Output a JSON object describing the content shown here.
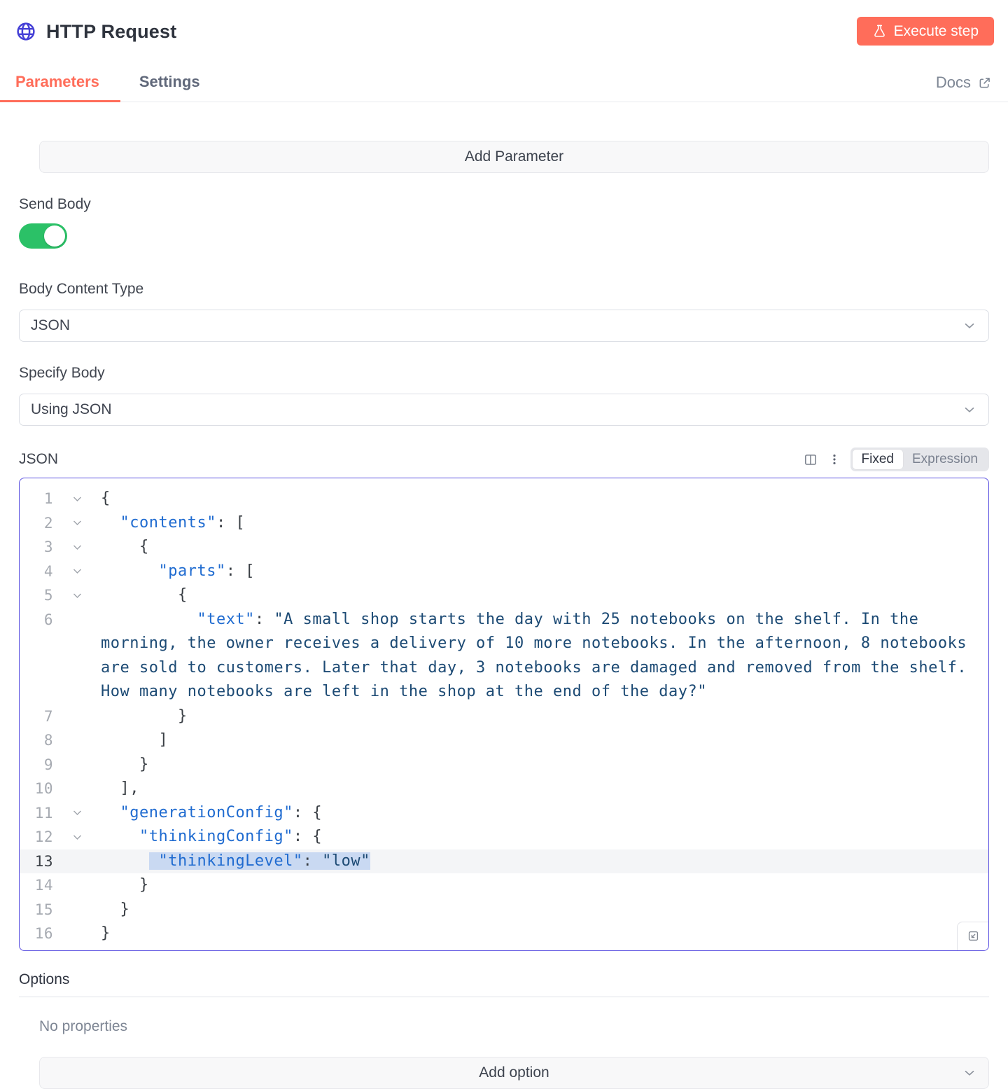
{
  "header": {
    "title": "HTTP Request",
    "execute_button": "Execute step"
  },
  "tabs": {
    "parameters": "Parameters",
    "settings": "Settings",
    "docs": "Docs"
  },
  "params": {
    "add_parameter_label": "Add Parameter",
    "send_body_label": "Send Body",
    "send_body_on": true,
    "body_content_type_label": "Body Content Type",
    "body_content_type_value": "JSON",
    "specify_body_label": "Specify Body",
    "specify_body_value": "Using JSON",
    "json_label": "JSON",
    "mode_fixed": "Fixed",
    "mode_expression": "Expression",
    "options_label": "Options",
    "no_properties_text": "No properties",
    "add_option_label": "Add option"
  },
  "icons": {
    "node": "globe-icon",
    "execute": "flask-icon",
    "docs": "external-link-icon",
    "split": "split-editor-icon",
    "menu": "kebab-menu-icon",
    "expand": "expand-editor-icon"
  },
  "colors": {
    "accent": "#ff6d5a",
    "node-icon": "#4540d6",
    "toggle-green": "#2bc167",
    "sel": "#c9d9f2",
    "tok-key": "#1f6bd0",
    "tok-str": "#1c4a74",
    "tok-punct": "#3a3f45",
    "editor-border": "#5a50e0"
  },
  "editor": {
    "lines": [
      {
        "num": 1,
        "fold": true,
        "segments": [
          {
            "t": "{",
            "c": "p"
          }
        ]
      },
      {
        "num": 2,
        "fold": true,
        "segments": [
          {
            "t": "  ",
            "c": "p"
          },
          {
            "t": "\"contents\"",
            "c": "k"
          },
          {
            "t": ": [",
            "c": "p"
          }
        ]
      },
      {
        "num": 3,
        "fold": true,
        "segments": [
          {
            "t": "    {",
            "c": "p"
          }
        ]
      },
      {
        "num": 4,
        "fold": true,
        "segments": [
          {
            "t": "      ",
            "c": "p"
          },
          {
            "t": "\"parts\"",
            "c": "k"
          },
          {
            "t": ": [",
            "c": "p"
          }
        ]
      },
      {
        "num": 5,
        "fold": true,
        "segments": [
          {
            "t": "        {",
            "c": "p"
          }
        ]
      },
      {
        "num": 6,
        "fold": false,
        "segments": [
          {
            "t": "          ",
            "c": "p"
          },
          {
            "t": "\"text\"",
            "c": "k"
          },
          {
            "t": ": ",
            "c": "p"
          },
          {
            "t": "\"A small shop starts the day with 25 notebooks on the shelf. In the morning, the owner receives a delivery of 10 more notebooks. In the afternoon, 8 notebooks are sold to customers. Later that day, 3 notebooks are damaged and removed from the shelf. How many notebooks are left in the shop at the end of the day?\"",
            "c": "s"
          }
        ]
      },
      {
        "num": 7,
        "fold": false,
        "segments": [
          {
            "t": "        }",
            "c": "p"
          }
        ]
      },
      {
        "num": 8,
        "fold": false,
        "segments": [
          {
            "t": "      ]",
            "c": "p"
          }
        ]
      },
      {
        "num": 9,
        "fold": false,
        "segments": [
          {
            "t": "    }",
            "c": "p"
          }
        ]
      },
      {
        "num": 10,
        "fold": false,
        "segments": [
          {
            "t": "  ],",
            "c": "p"
          }
        ]
      },
      {
        "num": 11,
        "fold": true,
        "segments": [
          {
            "t": "  ",
            "c": "p"
          },
          {
            "t": "\"generationConfig\"",
            "c": "k"
          },
          {
            "t": ": {",
            "c": "p"
          }
        ]
      },
      {
        "num": 12,
        "fold": true,
        "segments": [
          {
            "t": "    ",
            "c": "p"
          },
          {
            "t": "\"thinkingConfig\"",
            "c": "k"
          },
          {
            "t": ": {",
            "c": "p"
          }
        ]
      },
      {
        "num": 13,
        "fold": false,
        "active": true,
        "segments": [
          {
            "t": "     ",
            "c": "p"
          },
          {
            "t": " ",
            "c": "p",
            "sel": true
          },
          {
            "t": "\"thinkingLevel\"",
            "c": "k",
            "sel": true
          },
          {
            "t": ": ",
            "c": "p",
            "sel": true
          },
          {
            "t": "\"low\"",
            "c": "s",
            "sel": true
          }
        ]
      },
      {
        "num": 14,
        "fold": false,
        "segments": [
          {
            "t": "    }",
            "c": "p"
          }
        ]
      },
      {
        "num": 15,
        "fold": false,
        "segments": [
          {
            "t": "  }",
            "c": "p"
          }
        ]
      },
      {
        "num": 16,
        "fold": false,
        "segments": [
          {
            "t": "}",
            "c": "p"
          }
        ]
      }
    ]
  }
}
